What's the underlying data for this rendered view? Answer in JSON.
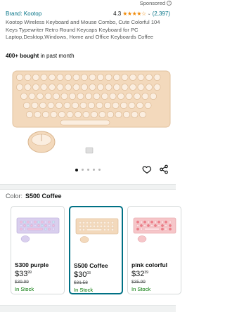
{
  "header": {
    "sponsored": "Sponsored",
    "brand": "Brand: Kootop",
    "rating_value": "4.3",
    "rating_stars": 4.3,
    "rating_count": "(2,397)"
  },
  "product": {
    "title": "Kootop Wireless Keyboard and Mouse Combo, Cute Colorful 104 Keys Typewriter Retro Round Keycaps Keyboard for PC Laptop,Desktop,Windows, Home and Office Keyboards Coffee",
    "bought_bold": "400+ bought",
    "bought_rest": " in past month"
  },
  "gallery": {
    "image_count": 5,
    "active_index": 0,
    "icons": [
      "heart-icon",
      "share-icon"
    ]
  },
  "variants": {
    "label": "Color:",
    "selected": "S500 Coffee",
    "options": [
      {
        "name": "S300 purple",
        "price_whole": "$33",
        "price_cents": "99",
        "list_price": "$39.99",
        "stock": "In Stock",
        "selected": false
      },
      {
        "name": "S500 Coffee",
        "price_whole": "$30",
        "price_cents": "03",
        "list_price": "$31.58",
        "stock": "In Stock",
        "selected": true
      },
      {
        "name": "pink colorful",
        "price_whole": "$32",
        "price_cents": "39",
        "list_price": "$35.99",
        "stock": "In Stock",
        "selected": false
      }
    ]
  },
  "colors": {
    "link": "#007185",
    "stars": "#f08804",
    "in_stock": "#007600",
    "keyboard": "#f3d9bc"
  }
}
